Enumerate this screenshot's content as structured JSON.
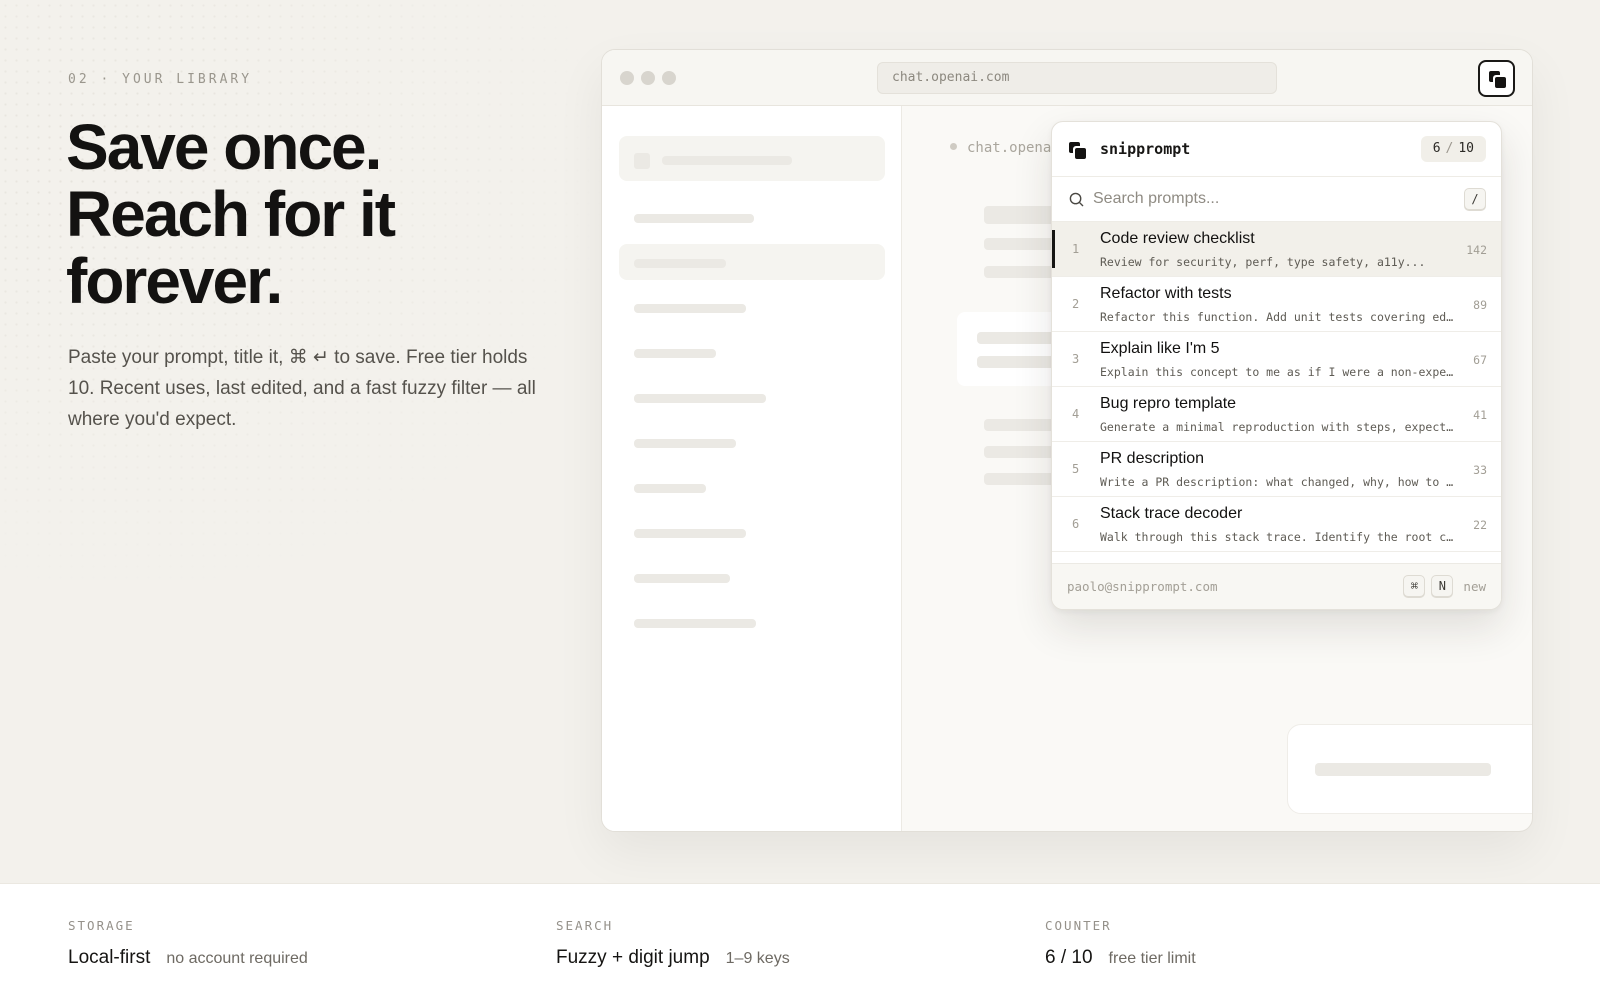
{
  "hero": {
    "eyebrow": "02 · YOUR LIBRARY",
    "headline_1": "Save once.",
    "headline_2": "Reach for it",
    "headline_3": "forever.",
    "lede": "Paste your prompt, title it, ⌘ ↵ to save. Free tier holds 10. Recent uses, last edited, and a fast fuzzy filter — all where you'd expect."
  },
  "browser": {
    "url": "chat.openai.com",
    "page_crumb": "chat.opena"
  },
  "popup": {
    "title": "snipprompt",
    "count_used": "6",
    "count_sep": "/",
    "count_total": "10",
    "search_placeholder": "Search prompts...",
    "search_shortcut": "/",
    "items": [
      {
        "index": "1",
        "name": "Code review checklist",
        "desc": "Review for security, perf, type safety, a11y...",
        "uses": "142"
      },
      {
        "index": "2",
        "name": "Refactor with tests",
        "desc": "Refactor this function. Add unit tests covering edge cases.",
        "uses": "89"
      },
      {
        "index": "3",
        "name": "Explain like I'm 5",
        "desc": "Explain this concept to me as if I were a non-expert.",
        "uses": "67"
      },
      {
        "index": "4",
        "name": "Bug repro template",
        "desc": "Generate a minimal reproduction with steps, expected result.",
        "uses": "41"
      },
      {
        "index": "5",
        "name": "PR description",
        "desc": "Write a PR description: what changed, why, how to test.",
        "uses": "33"
      },
      {
        "index": "6",
        "name": "Stack trace decoder",
        "desc": "Walk through this stack trace. Identify the root cause.",
        "uses": "22"
      }
    ],
    "footer_email": "paolo@snipprompt.com",
    "footer_key_1": "⌘",
    "footer_key_2": "N",
    "footer_action": "new"
  },
  "stats": [
    {
      "label": "STORAGE",
      "value": "Local-first",
      "note": "no account required"
    },
    {
      "label": "SEARCH",
      "value": "Fuzzy + digit jump",
      "note": "1–9 keys"
    },
    {
      "label": "COUNTER",
      "value": "6 / 10",
      "note": "free tier limit"
    }
  ],
  "icons": {
    "logo": "snipprompt-logo-icon",
    "search": "search-icon",
    "browser_dots": "traffic-light-icon"
  },
  "colors": {
    "background": "#f3f1ec",
    "ink": "#161513",
    "active_row": "#f2f0ea"
  }
}
